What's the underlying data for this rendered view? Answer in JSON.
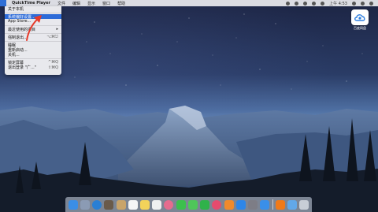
{
  "menubar": {
    "apple_glyph": "",
    "app_name": "QuickTime Player",
    "menus": [
      "文件",
      "编辑",
      "显示",
      "窗口",
      "帮助"
    ],
    "time": "上午 4:53"
  },
  "apple_menu": {
    "items": [
      {
        "label": "关于本机",
        "shortcut": "",
        "submenu": false,
        "selected": false
      },
      {
        "separator": true
      },
      {
        "label": "系统偏好设置...",
        "shortcut": "",
        "submenu": false,
        "selected": true
      },
      {
        "label": "App Store...",
        "shortcut": "",
        "submenu": false,
        "selected": false
      },
      {
        "separator": true
      },
      {
        "label": "最近使用的项目",
        "shortcut": "",
        "submenu": true,
        "selected": false
      },
      {
        "separator": true
      },
      {
        "label": "强制退出...",
        "shortcut": "⌥⌘⎋",
        "submenu": false,
        "selected": false
      },
      {
        "separator": true
      },
      {
        "label": "睡眠",
        "shortcut": "",
        "submenu": false,
        "selected": false
      },
      {
        "label": "重新启动...",
        "shortcut": "",
        "submenu": false,
        "selected": false
      },
      {
        "label": "关机...",
        "shortcut": "",
        "submenu": false,
        "selected": false
      },
      {
        "separator": true
      },
      {
        "label": "锁定屏幕",
        "shortcut": "^⌘Q",
        "submenu": false,
        "selected": false
      },
      {
        "label": "退出登录 \"广...\"",
        "shortcut": "⇧⌘Q",
        "submenu": false,
        "selected": false
      }
    ]
  },
  "desktop_app": {
    "label": "百度网盘",
    "icon": "cloud-icon",
    "color": "#2f7fe0"
  },
  "dock": {
    "apps": [
      {
        "name": "finder-icon",
        "color": "#3a8ee6"
      },
      {
        "name": "launchpad-icon",
        "color": "#8b9bb4"
      },
      {
        "name": "safari-icon",
        "color": "#2a7fd4"
      },
      {
        "name": "photo-icon",
        "color": "#6a5a4a"
      },
      {
        "name": "contacts-icon",
        "color": "#c9a46a"
      },
      {
        "name": "calendar-icon",
        "color": "#f5f5f5"
      },
      {
        "name": "notes-icon",
        "color": "#f2d35a"
      },
      {
        "name": "reminders-icon",
        "color": "#f0f0f0"
      },
      {
        "name": "photos-icon",
        "color": "#e56c8e"
      },
      {
        "name": "facetime-icon",
        "color": "#3cbf4d"
      },
      {
        "name": "messages-icon",
        "color": "#4fc65a"
      },
      {
        "name": "wechat-icon",
        "color": "#2fb24a"
      },
      {
        "name": "itunes-icon",
        "color": "#e54b6e"
      },
      {
        "name": "books-icon",
        "color": "#f08a2c"
      },
      {
        "name": "app-store-icon",
        "color": "#2d86e8"
      },
      {
        "name": "preferences-icon",
        "color": "#7d7d86"
      },
      {
        "name": "baidu-netdisk-icon",
        "color": "#3a8fe8"
      },
      {
        "name": "vlc-icon",
        "color": "#f07a19"
      },
      {
        "name": "folder-icon",
        "color": "#62a8e8"
      },
      {
        "name": "trash-icon",
        "color": "#c8ced6"
      }
    ]
  }
}
